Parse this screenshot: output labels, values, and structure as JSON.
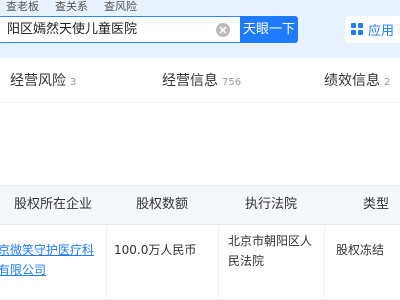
{
  "header": {
    "top_links": [
      "查老板",
      "查关系",
      "查风险"
    ],
    "search": {
      "value": "阳区嫣然天使儿童医院"
    },
    "search_button_label": "天眼一下",
    "apps_label": "应用"
  },
  "tabs": [
    {
      "label": "经营风险",
      "count": "3"
    },
    {
      "label": "经营信息",
      "count": "756"
    },
    {
      "label": "绩效信息",
      "count": "2"
    }
  ],
  "table": {
    "headers": [
      "股权所在企业",
      "股权数额",
      "执行法院",
      "类型"
    ],
    "rows": [
      {
        "company_line1": "京微笑守护医疗科",
        "company_line2": "有限公司",
        "amount": "100.0万人民币",
        "court_line1": "北京市朝阳区人",
        "court_line2": "民法院",
        "type": "股权冻结"
      }
    ]
  },
  "colors": {
    "accent": "#1f7bff",
    "header_bg": "#e8f2ff",
    "table_header_bg": "#f4f7fc"
  }
}
